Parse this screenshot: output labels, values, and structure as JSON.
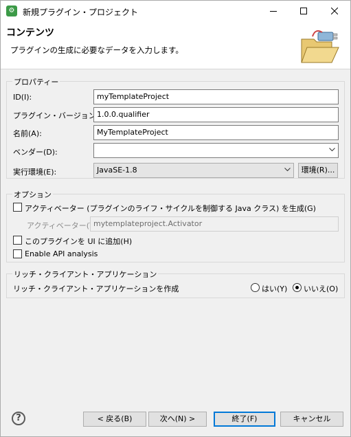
{
  "window": {
    "title": "新規プラグイン・プロジェクト",
    "app_icon": "plugin-icon",
    "controls": [
      "minimize-icon",
      "maximize-icon",
      "close-icon"
    ]
  },
  "header": {
    "title": "コンテンツ",
    "description": "プラグインの生成に必要なデータを入力します。",
    "image": "folder-plugin-illustration"
  },
  "properties": {
    "group_label": "プロパティー",
    "id_label": "ID(I):",
    "id_value": "myTemplateProject",
    "version_label": "プラグイン・バージョン(V):",
    "version_value": "1.0.0.qualifier",
    "name_label": "名前(A):",
    "name_value": "MyTemplateProject",
    "vendor_label": "ベンダー(D):",
    "vendor_value": "",
    "env_label": "実行環境(E):",
    "env_value": "JavaSE-1.8",
    "env_button": "環境(R)..."
  },
  "options": {
    "group_label": "オプション",
    "activator_check_label": "アクティベーター (プラグインのライフ・サイクルを制御する Java クラス) を生成(G)",
    "activator_checked": false,
    "activator_field_label": "アクティベーター(T):",
    "activator_field_value": "mytemplateproject.Activator",
    "ui_check_label": "このプラグインを UI に追加(H)",
    "ui_checked": false,
    "api_check_label": "Enable API analysis",
    "api_checked": false
  },
  "rcp": {
    "group_label": "リッチ・クライアント・アプリケーション",
    "question": "リッチ・クライアント・アプリケーションを作成",
    "yes_label": "はい(Y)",
    "no_label": "いいえ(O)",
    "selected": "no"
  },
  "footer": {
    "help_icon": "help-icon",
    "help_glyph": "?",
    "back": "< 戻る(B)",
    "next": "次へ(N) >",
    "finish": "終了(F)",
    "cancel": "キャンセル"
  },
  "colors": {
    "accent": "#0078d7",
    "dialog_bg": "#f0f0f0"
  }
}
